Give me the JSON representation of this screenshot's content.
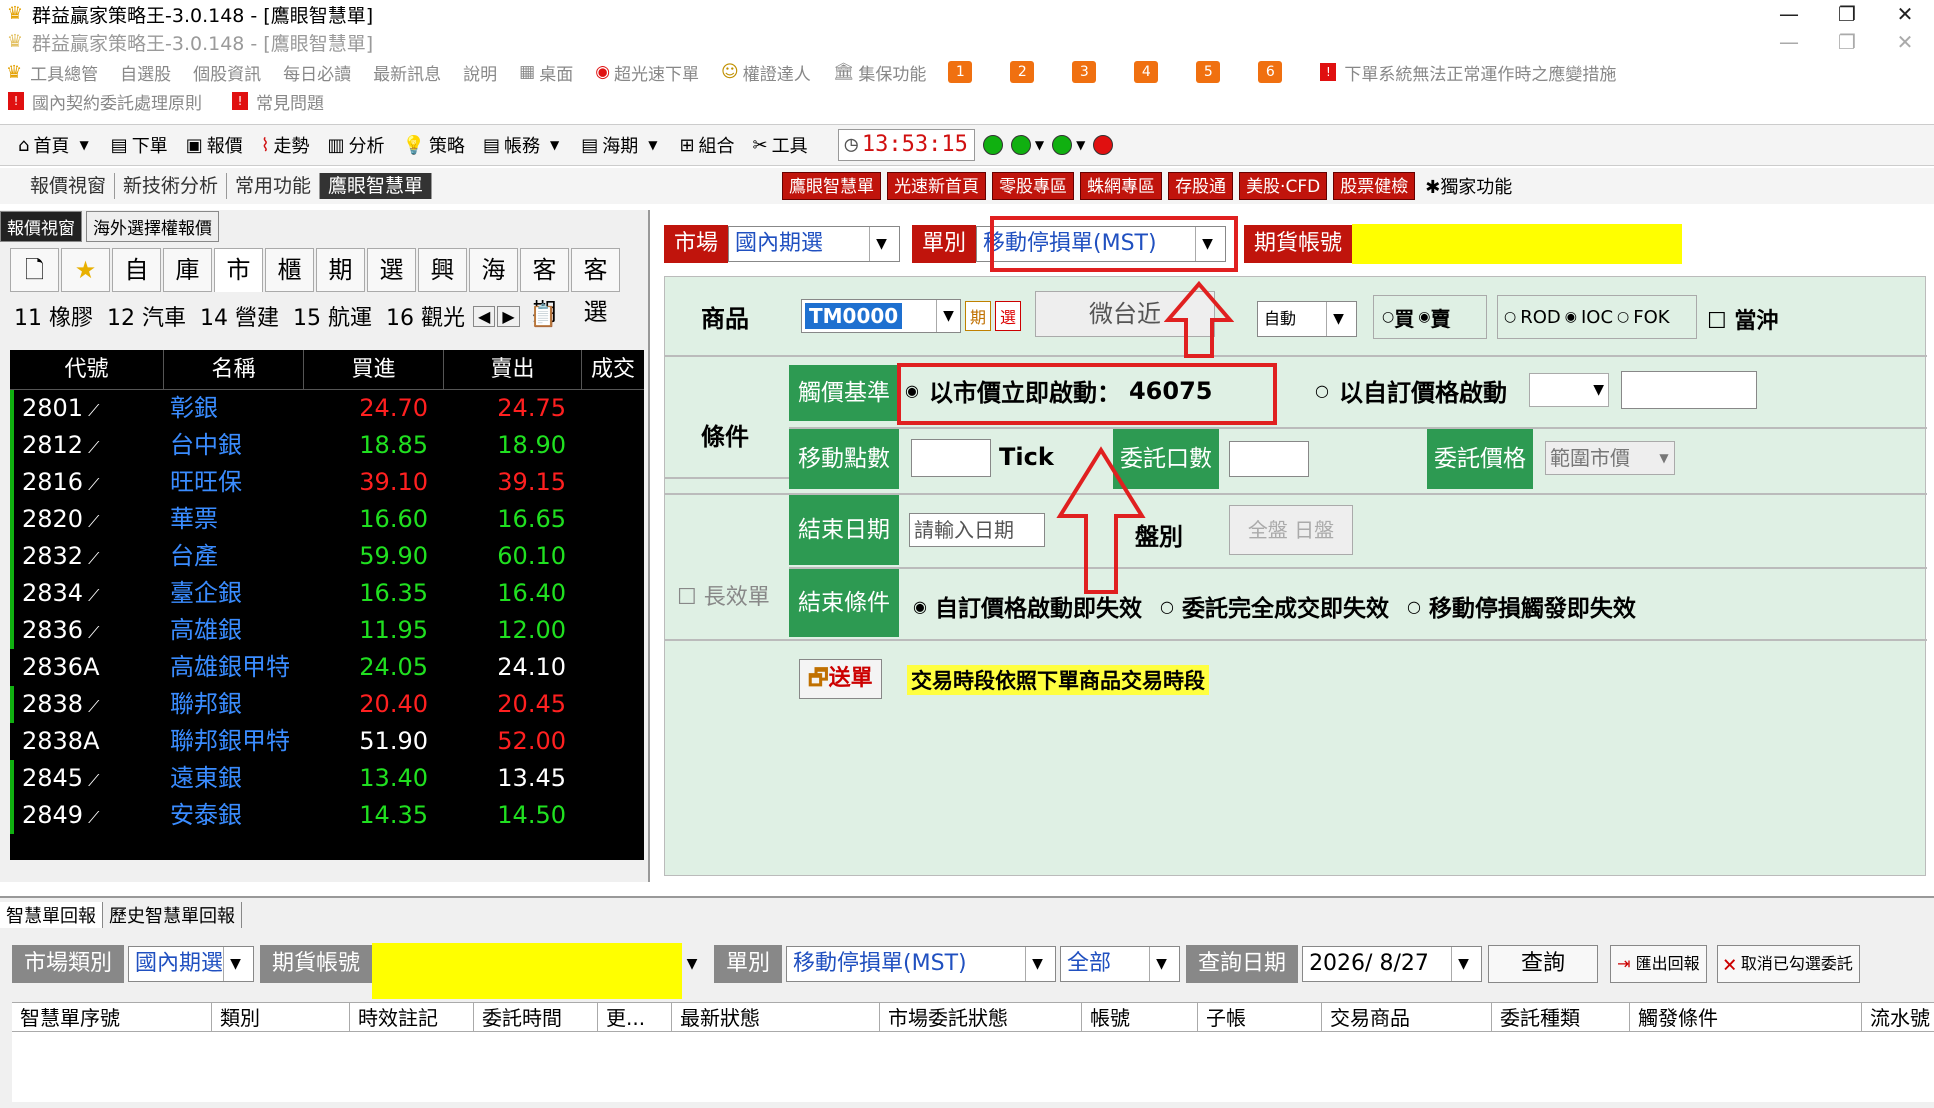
{
  "window": {
    "title": "群益贏家策略王-3.0.148 - [鷹眼智慧單]",
    "inner_title": "群益贏家策略王-3.0.148 - [鷹眼智慧單]"
  },
  "menu": {
    "items": [
      "工具總管",
      "自選股",
      "個股資訊",
      "每日必讀",
      "最新訊息",
      "說明",
      "桌面",
      "超光速下單",
      "權證達人",
      "集保功能"
    ],
    "numbered": [
      "1",
      "2",
      "3",
      "4",
      "5",
      "6"
    ],
    "notice": "下單系統無法正常運作時之應變措施",
    "sub_items": [
      "國內契約委託處理原則",
      "常見問題"
    ]
  },
  "toolbar": {
    "items": [
      "首頁",
      "下單",
      "報價",
      "走勢",
      "分析",
      "策略",
      "帳務",
      "海期",
      "組合",
      "工具"
    ],
    "clock": "13:53:15",
    "status_colors": [
      "#10b010",
      "#10b010",
      "#10b010",
      "#e01010"
    ]
  },
  "toolbar2": {
    "tabs": [
      "報價視窗",
      "新技術分析",
      "常用功能",
      "鷹眼智慧單"
    ],
    "buttons": [
      "鷹眼智慧單",
      "光速新首頁",
      "零股專區",
      "蛛網專區",
      "存股通",
      "美股·CFD",
      "股票健檢"
    ],
    "extra": "獨家功能"
  },
  "quote": {
    "tabs": [
      "報價視窗",
      "海外選擇權報價"
    ],
    "filters": [
      "",
      "",
      "自",
      "庫",
      "市",
      "櫃",
      "期",
      "選",
      "興",
      "海",
      "客期",
      "客選"
    ],
    "categories": [
      "11 橡膠",
      "12 汽車",
      "14 營建",
      "15 航運",
      "16 觀光"
    ],
    "headers": [
      "代號",
      "名稱",
      "買進",
      "賣出",
      "成交"
    ],
    "rows": [
      {
        "code": "2801",
        "name": "彰銀",
        "bid": "24.70",
        "ask": "24.75",
        "bidc": "red",
        "askc": "red"
      },
      {
        "code": "2812",
        "name": "台中銀",
        "bid": "18.85",
        "ask": "18.90",
        "bidc": "green",
        "askc": "green"
      },
      {
        "code": "2816",
        "name": "旺旺保",
        "bid": "39.10",
        "ask": "39.15",
        "bidc": "red",
        "askc": "red"
      },
      {
        "code": "2820",
        "name": "華票",
        "bid": "16.60",
        "ask": "16.65",
        "bidc": "green",
        "askc": "green"
      },
      {
        "code": "2832",
        "name": "台產",
        "bid": "59.90",
        "ask": "60.10",
        "bidc": "green",
        "askc": "green"
      },
      {
        "code": "2834",
        "name": "臺企銀",
        "bid": "16.35",
        "ask": "16.40",
        "bidc": "green",
        "askc": "green"
      },
      {
        "code": "2836",
        "name": "高雄銀",
        "bid": "11.95",
        "ask": "12.00",
        "bidc": "green",
        "askc": "green"
      },
      {
        "code": "2836A",
        "name": "高雄銀甲特",
        "bid": "24.05",
        "ask": "24.10",
        "bidc": "green",
        "askc": "white"
      },
      {
        "code": "2838",
        "name": "聯邦銀",
        "bid": "20.40",
        "ask": "20.45",
        "bidc": "red",
        "askc": "red"
      },
      {
        "code": "2838A",
        "name": "聯邦銀甲特",
        "bid": "51.90",
        "ask": "52.00",
        "bidc": "white",
        "askc": "red"
      },
      {
        "code": "2845",
        "name": "遠東銀",
        "bid": "13.40",
        "ask": "13.45",
        "bidc": "green",
        "askc": "white"
      },
      {
        "code": "2849",
        "name": "安泰銀",
        "bid": "14.35",
        "ask": "14.50",
        "bidc": "green",
        "askc": "green"
      }
    ]
  },
  "order": {
    "market_label": "市場",
    "market_value": "國內期選",
    "type_label": "單別",
    "type_value": "移動停損單(MST)",
    "account_label": "期貨帳號",
    "product_label": "商品",
    "product_code": "TM0000",
    "btn_period": "期",
    "btn_select": "選",
    "product_name": "微台近",
    "auto_value": "自動",
    "buy": "買",
    "sell": "賣",
    "rod": "ROD",
    "ioc": "IOC",
    "fok": "FOK",
    "daytrade": "當沖",
    "condition_label": "條件",
    "trigger_base": "觸價基準",
    "market_trigger": "以市價立即啟動：",
    "market_trigger_value": "46075",
    "custom_trigger": "以自訂價格啟動",
    "move_points": "移動點數",
    "tick": "Tick",
    "order_qty": "委託口數",
    "order_price": "委託價格",
    "price_range": "範圍市價",
    "long_order": "長效單",
    "end_date": "結束日期",
    "date_placeholder": "請輸入日期",
    "session": "盤別",
    "session_all": "全盤",
    "session_day": "日盤",
    "end_condition": "結束條件",
    "end1": "自訂價格啟動即失效",
    "end2": "委託完全成交即失效",
    "end3": "移動停損觸發即失效",
    "send": "送單",
    "session_note": "交易時段依照下單商品交易時段"
  },
  "bottom": {
    "tabs": [
      "智慧單回報",
      "歷史智慧單回報"
    ],
    "market_label": "市場類別",
    "market_value": "國內期選",
    "account_label": "期貨帳號",
    "type_label": "單別",
    "type_value": "移動停損單(MST)",
    "scope_value": "全部",
    "date_label": "查詢日期",
    "date_value": "2026/  8/27",
    "query": "查詢",
    "export": "匯出回報",
    "cancel": "取消已勾選委託",
    "headers": [
      "智慧單序號",
      "類別",
      "時效註記",
      "委託時間",
      "更...",
      "最新狀態",
      "市場委託狀態",
      "帳號",
      "子帳",
      "交易商品",
      "委託種類",
      "觸發條件",
      "流水號"
    ]
  }
}
